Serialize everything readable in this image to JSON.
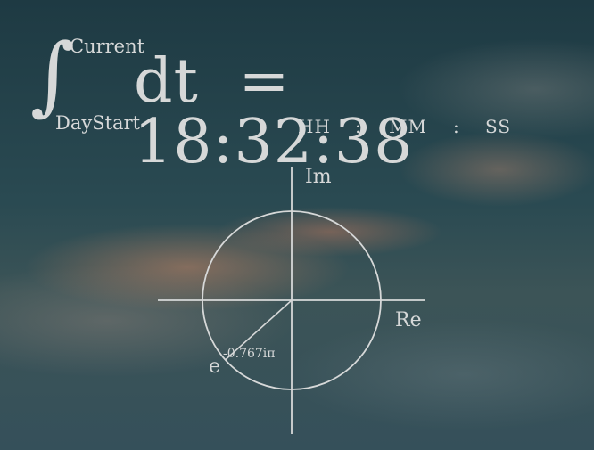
{
  "integral": {
    "symbol": "∫",
    "upper_limit": "Current",
    "lower_limit": "DayStart",
    "integrand": "dt",
    "equals": "="
  },
  "clock": {
    "time": "18:32:38",
    "unit_hours": "HH",
    "sep1": ":",
    "unit_minutes": "MM",
    "sep2": ":",
    "unit_seconds": "SS"
  },
  "complex_plane": {
    "imag_label": "Im",
    "real_label": "Re",
    "exp_base": "e",
    "exponent": "-0.767iπ",
    "angle_pi_fraction": -0.767
  }
}
